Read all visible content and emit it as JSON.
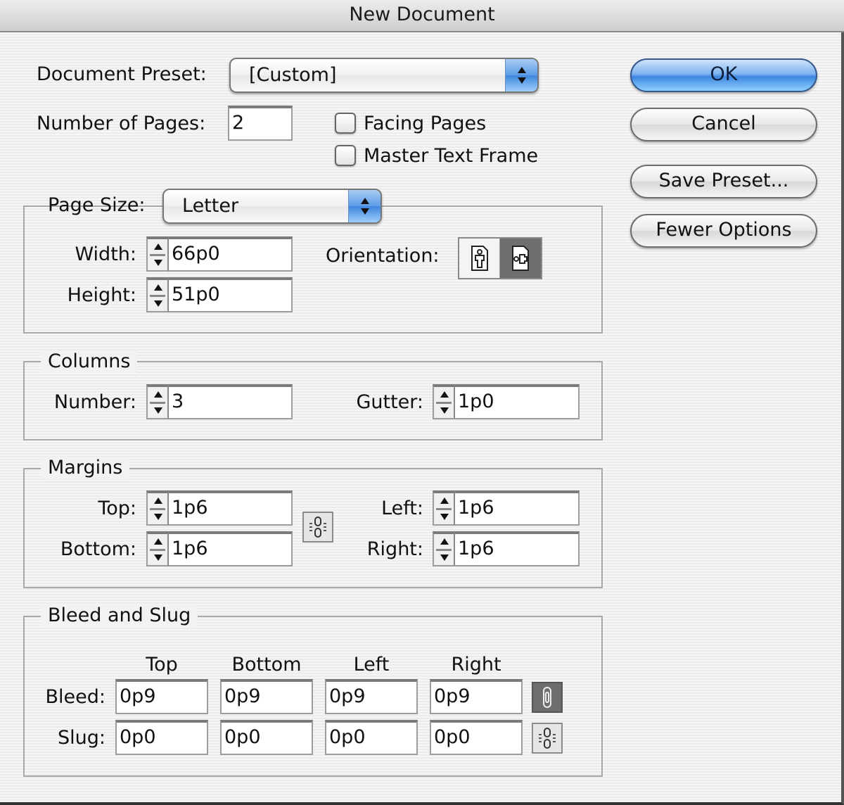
{
  "window": {
    "title": "New Document"
  },
  "document_preset": {
    "label": "Document Preset:",
    "value": "[Custom]"
  },
  "number_of_pages": {
    "label": "Number of Pages:",
    "value": "2"
  },
  "checkboxes": {
    "facing_pages": {
      "label": "Facing Pages",
      "checked": false
    },
    "master_text_frame": {
      "label": "Master Text Frame",
      "checked": false
    }
  },
  "buttons": {
    "ok": "OK",
    "cancel": "Cancel",
    "save_preset": "Save Preset...",
    "fewer_options": "Fewer Options"
  },
  "page_size": {
    "label": "Page Size:",
    "value": "Letter",
    "width_label": "Width:",
    "width": "66p0",
    "height_label": "Height:",
    "height": "51p0",
    "orientation_label": "Orientation:",
    "orientation_options": [
      "portrait",
      "landscape"
    ],
    "orientation_selected": "landscape"
  },
  "columns": {
    "title": "Columns",
    "number_label": "Number:",
    "number": "3",
    "gutter_label": "Gutter:",
    "gutter": "1p0"
  },
  "margins": {
    "title": "Margins",
    "top_label": "Top:",
    "top": "1p6",
    "bottom_label": "Bottom:",
    "bottom": "1p6",
    "left_label": "Left:",
    "left": "1p6",
    "right_label": "Right:",
    "right": "1p6",
    "linked": false
  },
  "bleed_slug": {
    "title": "Bleed and Slug",
    "column_headers": [
      "Top",
      "Bottom",
      "Left",
      "Right"
    ],
    "bleed_label": "Bleed:",
    "bleed": [
      "0p9",
      "0p9",
      "0p9",
      "0p9"
    ],
    "bleed_linked": true,
    "slug_label": "Slug:",
    "slug": [
      "0p0",
      "0p0",
      "0p0",
      "0p0"
    ],
    "slug_linked": false
  },
  "colors": {
    "default_button": "#3d87e0",
    "popup_arrow": "#5c9be6"
  }
}
